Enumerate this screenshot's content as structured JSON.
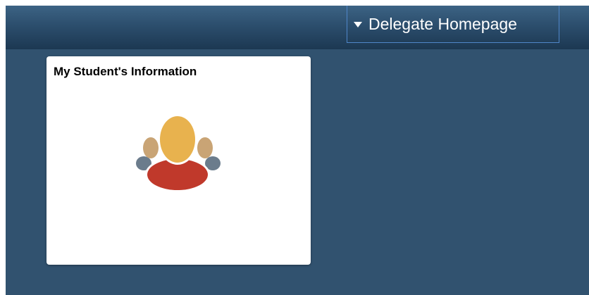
{
  "header": {
    "homepage_selector": {
      "label": "Delegate Homepage",
      "icon": "caret-down-icon"
    }
  },
  "tiles": [
    {
      "title": "My Student's Information",
      "icon": "people-group-icon"
    }
  ],
  "colors": {
    "background": "#31526f",
    "header_top": "#3c6384",
    "header_bottom": "#1c3852",
    "selector_border": "#4f86c9",
    "tile_bg": "#ffffff",
    "icon_head_main": "#e8b24e",
    "icon_body_main": "#c0392b",
    "icon_head_side": "#c9a475",
    "icon_body_side": "#6b7c8c"
  }
}
